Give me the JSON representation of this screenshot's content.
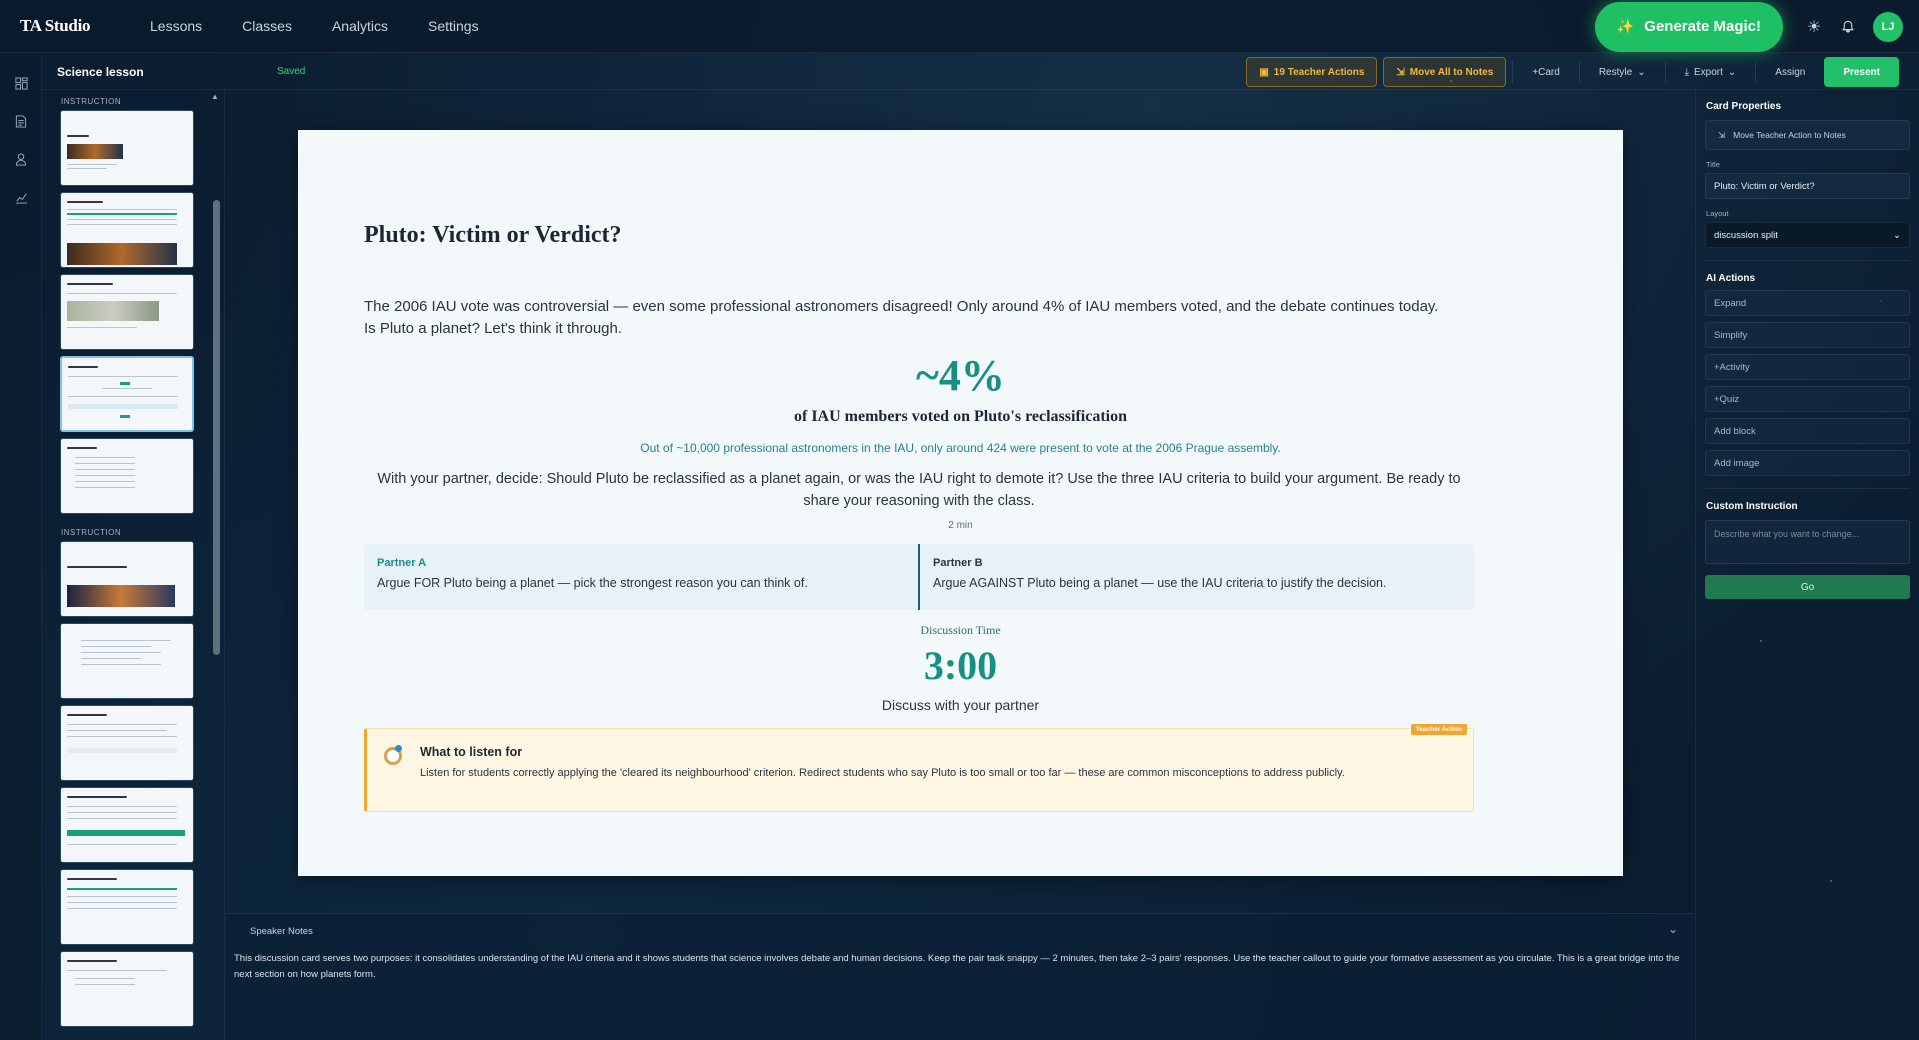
{
  "app": {
    "brand": "TA Studio",
    "nav": [
      "Lessons",
      "Classes",
      "Analytics",
      "Settings"
    ],
    "generate_label": "Generate Magic!",
    "avatar_initials": "LJ",
    "accent": "#22c069"
  },
  "toolbar": {
    "lesson_title": "Science lesson",
    "saved": "Saved",
    "teacher_actions": "19 Teacher Actions",
    "move_all": "Move All to Notes",
    "add_card": "+Card",
    "restyle": "Restyle",
    "export": "Export",
    "assign": "Assign",
    "present": "Present"
  },
  "thumbnails": {
    "sections": [
      "INSTRUCTION",
      "INSTRUCTION"
    ]
  },
  "card": {
    "title": "Pluto: Victim or Verdict?",
    "intro": "The 2006 IAU vote was controversial — even some professional astronomers disagreed! Only around 4% of IAU members voted, and the debate continues today. Is Pluto a planet? Let's think it through.",
    "stat": "~4%",
    "stat_label": "of IAU members voted on Pluto's reclassification",
    "stat_sub": "Out of ~10,000 professional astronomers in the IAU, only around 424 were present to vote at the 2006 Prague assembly.",
    "prompt": "With your partner, decide: Should Pluto be reclassified as a planet again, or was the IAU right to demote it? Use the three IAU criteria to build your argument. Be ready to share your reasoning with the class.",
    "duration": "2 min",
    "partner_a": {
      "name": "Partner A",
      "text": "Argue FOR Pluto being a planet — pick the strongest reason you can think of."
    },
    "partner_b": {
      "name": "Partner B",
      "text": "Argue AGAINST Pluto being a planet — use the IAU criteria to justify the decision."
    },
    "timer_label": "Discussion Time",
    "timer": "3:00",
    "timer_sub": "Discuss with your partner",
    "callout": {
      "badge": "Teacher Action",
      "title": "What to listen for",
      "text": "Listen for students correctly applying the 'cleared its neighbourhood' criterion. Redirect students who say Pluto is too small or too far — these are common misconceptions to address publicly."
    }
  },
  "notes": {
    "heading": "Speaker Notes",
    "text": "This discussion card serves two purposes: it consolidates understanding of the IAU criteria and it shows students that science involves debate and human decisions. Keep the pair task snappy — 2 minutes, then take 2–3 pairs' responses. Use the teacher callout to guide your formative assessment as you circulate. This is a great bridge into the next section on how planets form."
  },
  "props": {
    "heading": "Card Properties",
    "move_action": "Move Teacher Action to Notes",
    "title_label": "Title",
    "title_value": "Pluto: Victim or Verdict?",
    "layout_label": "Layout",
    "layout_value": "discussion split",
    "ai_heading": "AI Actions",
    "ai_actions": [
      "Expand",
      "Simplify",
      "+Activity",
      "+Quiz",
      "Add block",
      "Add image"
    ],
    "custom_heading": "Custom Instruction",
    "custom_placeholder": "Describe what you want to change...",
    "go": "Go"
  }
}
